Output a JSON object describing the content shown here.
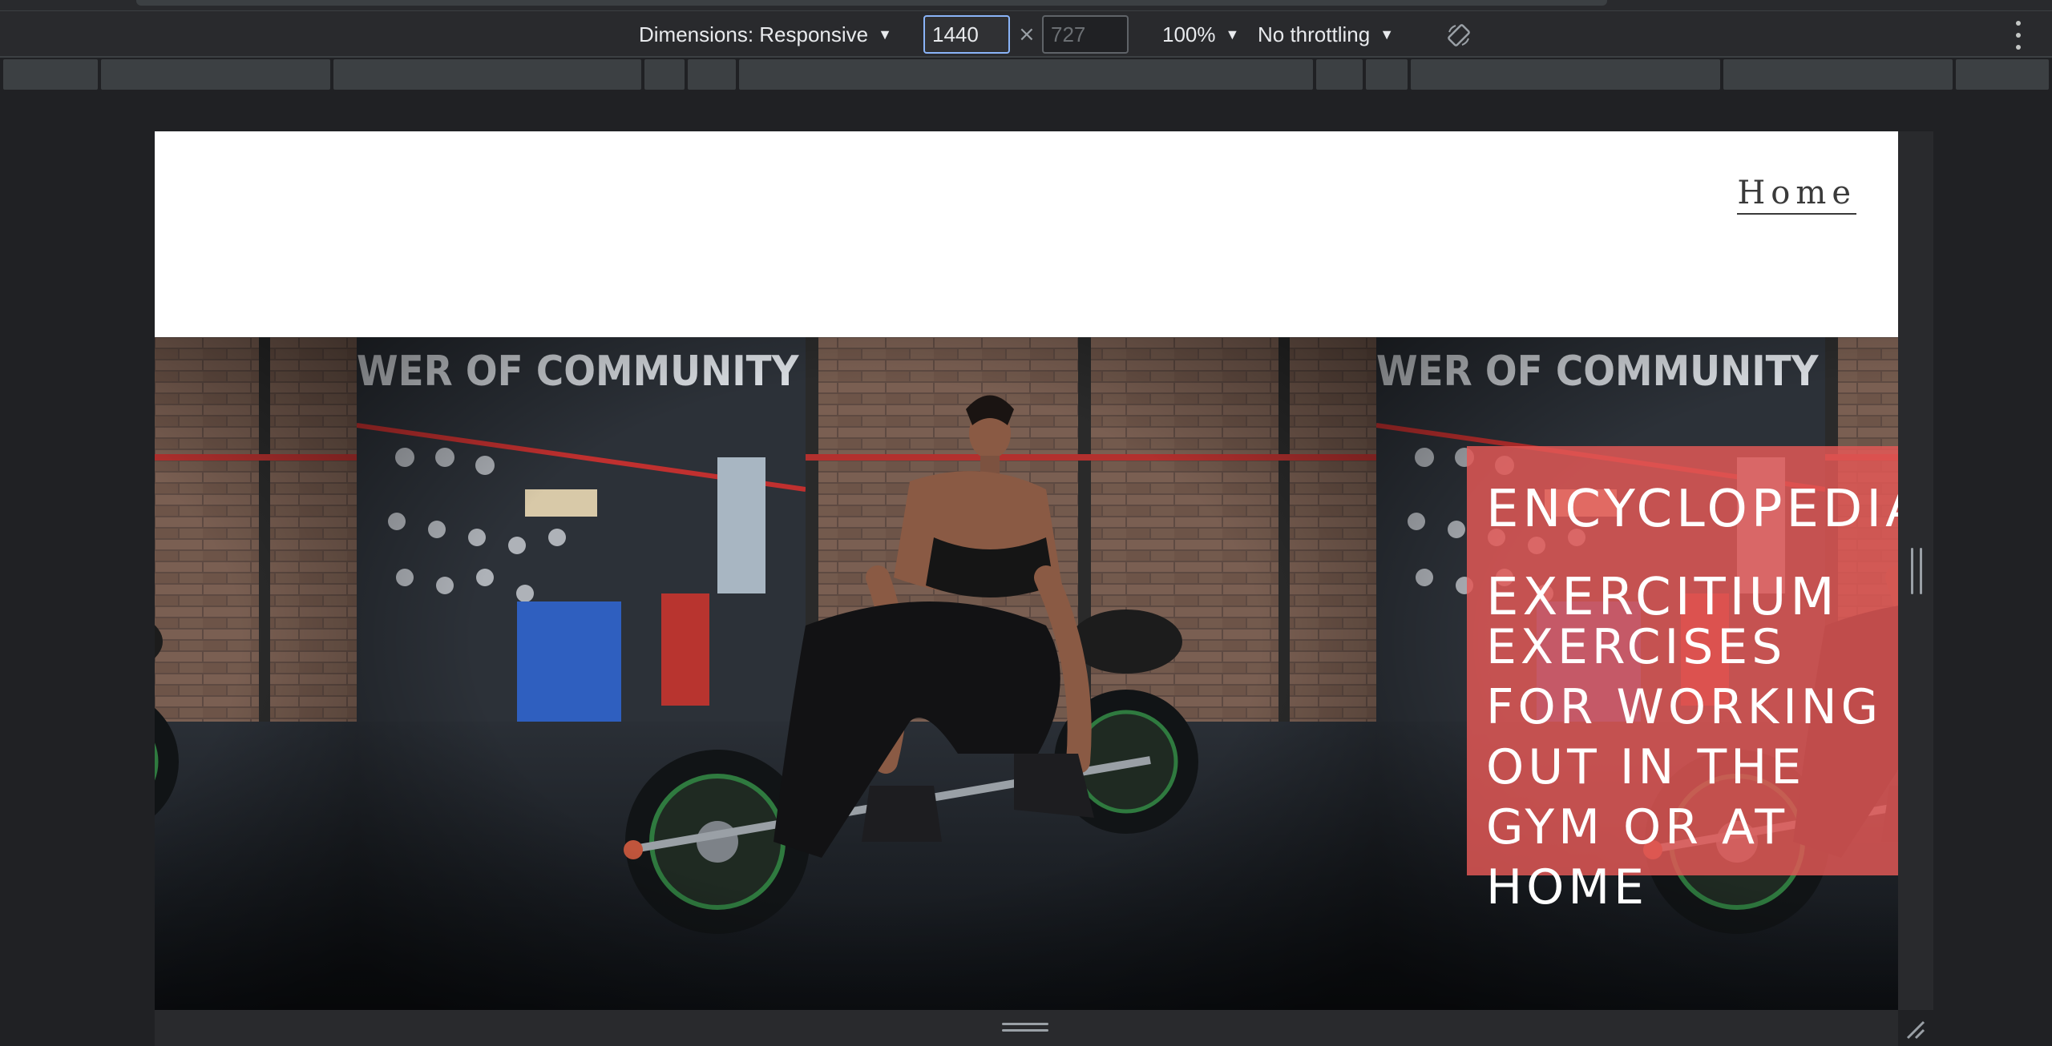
{
  "device_toolbar": {
    "dimensions_label": "Dimensions: Responsive",
    "width_value": "1440",
    "height_placeholder": "727",
    "times_symbol": "×",
    "zoom_label": "100%",
    "throttling_label": "No throttling",
    "caret": "▼",
    "icons": [
      "rotate-icon",
      "more-options-icon"
    ],
    "accent_color": "#8ab4f8"
  },
  "site": {
    "nav": {
      "home_label": "Home"
    },
    "hero": {
      "title_lines": [
        "ENCYCLOPEDIA",
        "EXERCITIUM"
      ],
      "subtitle": "EXERCISES FOR WORKING OUT IN THE GYM OR AT HOME",
      "card_color": "#e25856",
      "image_alt_text": "WER OF COMMUNITY",
      "image_description_icon": "weightlifting-photo"
    }
  }
}
